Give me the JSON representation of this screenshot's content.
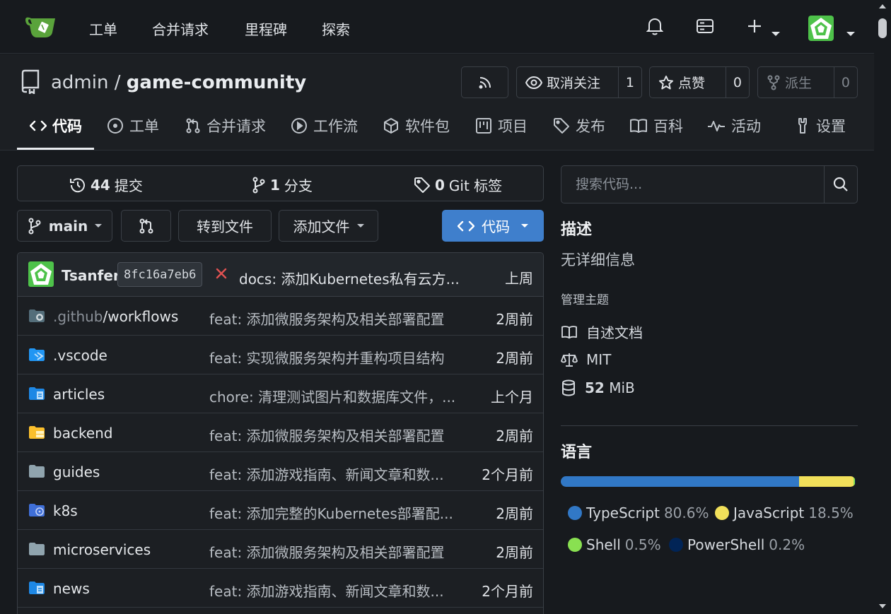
{
  "nav": {
    "links": [
      "工单",
      "合并请求",
      "里程碑",
      "探索"
    ]
  },
  "repo": {
    "owner": "admin",
    "separator": "/",
    "name": "game-community",
    "watch_label": "取消关注",
    "watch_count": "1",
    "star_label": "点赞",
    "star_count": "0",
    "fork_label": "派生",
    "fork_count": "0"
  },
  "tabs": [
    {
      "label": "代码",
      "icon": "code-icon",
      "active": true
    },
    {
      "label": "工单",
      "icon": "issue-icon"
    },
    {
      "label": "合并请求",
      "icon": "pull-request-icon"
    },
    {
      "label": "工作流",
      "icon": "play-icon"
    },
    {
      "label": "软件包",
      "icon": "package-icon"
    },
    {
      "label": "项目",
      "icon": "project-icon"
    },
    {
      "label": "发布",
      "icon": "tag-icon"
    },
    {
      "label": "百科",
      "icon": "book-icon"
    },
    {
      "label": "活动",
      "icon": "pulse-icon"
    },
    {
      "label": "设置",
      "icon": "tools-icon"
    }
  ],
  "stats": {
    "commits_count": "44",
    "commits_label": "提交",
    "branches_count": "1",
    "branches_label": "分支",
    "tags_count": "0",
    "tags_label": "Git 标签"
  },
  "toolbar": {
    "branch": "main",
    "goto_file": "转到文件",
    "add_file": "添加文件",
    "code": "代码"
  },
  "latest_commit": {
    "author": "Tsanfer",
    "sha": "8fc16a7eb6",
    "message": "docs: 添加Kubernetes私有云方...",
    "time": "上周"
  },
  "files": [
    {
      "name_dim": ".github",
      "name": "/workflows",
      "icon": "folder-github-icon",
      "message": "feat: 添加微服务架构及相关部署配置",
      "time": "2周前"
    },
    {
      "name_dim": "",
      "name": ".vscode",
      "icon": "folder-vscode-icon",
      "message": "feat: 实现微服务架构并重构项目结构",
      "time": "2周前"
    },
    {
      "name_dim": "",
      "name": "articles",
      "icon": "folder-docs-icon",
      "message": "chore: 清理测试图片和数据库文件，...",
      "time": "上个月"
    },
    {
      "name_dim": "",
      "name": "backend",
      "icon": "folder-server-icon",
      "message": "feat: 添加微服务架构及相关部署配置",
      "time": "2周前"
    },
    {
      "name_dim": "",
      "name": "guides",
      "icon": "folder-icon",
      "message": "feat: 添加游戏指南、新闻文章和数...",
      "time": "2个月前"
    },
    {
      "name_dim": "",
      "name": "k8s",
      "icon": "folder-kubernetes-icon",
      "message": "feat: 添加完整的Kubernetes部署配...",
      "time": "2周前"
    },
    {
      "name_dim": "",
      "name": "microservices",
      "icon": "folder-icon",
      "message": "feat: 添加微服务架构及相关部署配置",
      "time": "2周前"
    },
    {
      "name_dim": "",
      "name": "news",
      "icon": "folder-docs-icon",
      "message": "feat: 添加游戏指南、新闻文章和数...",
      "time": "2个月前"
    }
  ],
  "sidebar": {
    "search_placeholder": "搜索代码...",
    "desc_heading": "描述",
    "desc_text": "无详细信息",
    "topics_link": "管理主题",
    "readme": "自述文档",
    "license": "MIT",
    "size_value": "52",
    "size_unit": "MiB",
    "lang_heading": "语言"
  },
  "languages": [
    {
      "name": "TypeScript",
      "percent": "80.6%",
      "value": 80.6,
      "color": "#3178c6"
    },
    {
      "name": "JavaScript",
      "percent": "18.5%",
      "value": 18.5,
      "color": "#f1e05a"
    },
    {
      "name": "Shell",
      "percent": "0.5%",
      "value": 0.5,
      "color": "#89e051"
    },
    {
      "name": "PowerShell",
      "percent": "0.2%",
      "value": 0.2,
      "color": "#012456"
    }
  ]
}
